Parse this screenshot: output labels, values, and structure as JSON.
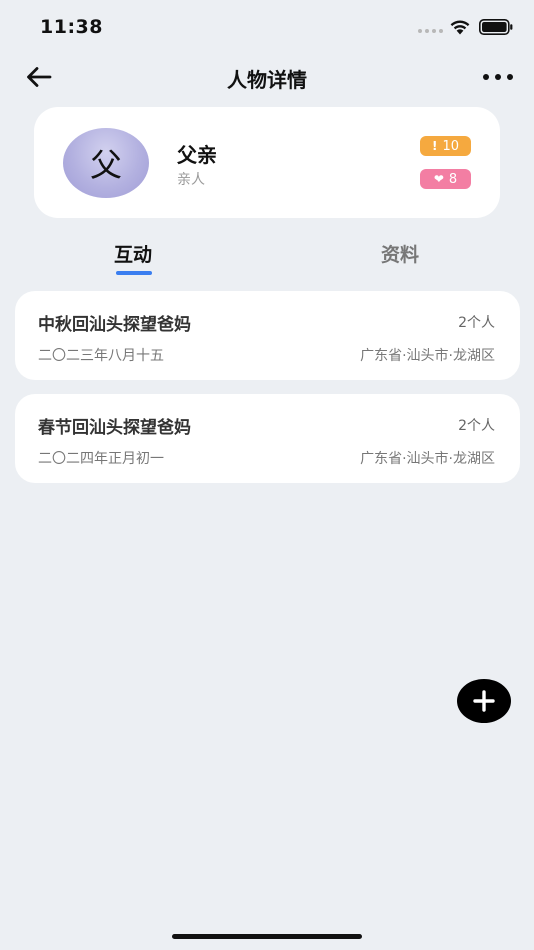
{
  "status_bar": {
    "time": "11:38"
  },
  "nav": {
    "title": "人物详情",
    "back_icon": "arrow-left-icon",
    "more_icon": "more-dots-icon"
  },
  "profile": {
    "avatar_text": "父",
    "name": "父亲",
    "relation": "亲人",
    "attention_badge": {
      "icon": "!",
      "count": "10",
      "color": "#f5a93f"
    },
    "like_badge": {
      "icon": "❤",
      "count": "8",
      "color": "#f37ea3"
    }
  },
  "tabs": [
    {
      "label": "互动",
      "active": true
    },
    {
      "label": "资料",
      "active": false
    }
  ],
  "accent_color": "#3a7ef0",
  "events": [
    {
      "title": "中秋回汕头探望爸妈",
      "count": "2个人",
      "date": "二〇二三年八月十五",
      "location": "广东省·汕头市·龙湖区"
    },
    {
      "title": "春节回汕头探望爸妈",
      "count": "2个人",
      "date": "二〇二四年正月初一",
      "location": "广东省·汕头市·龙湖区"
    }
  ],
  "fab": {
    "icon": "plus-icon"
  }
}
